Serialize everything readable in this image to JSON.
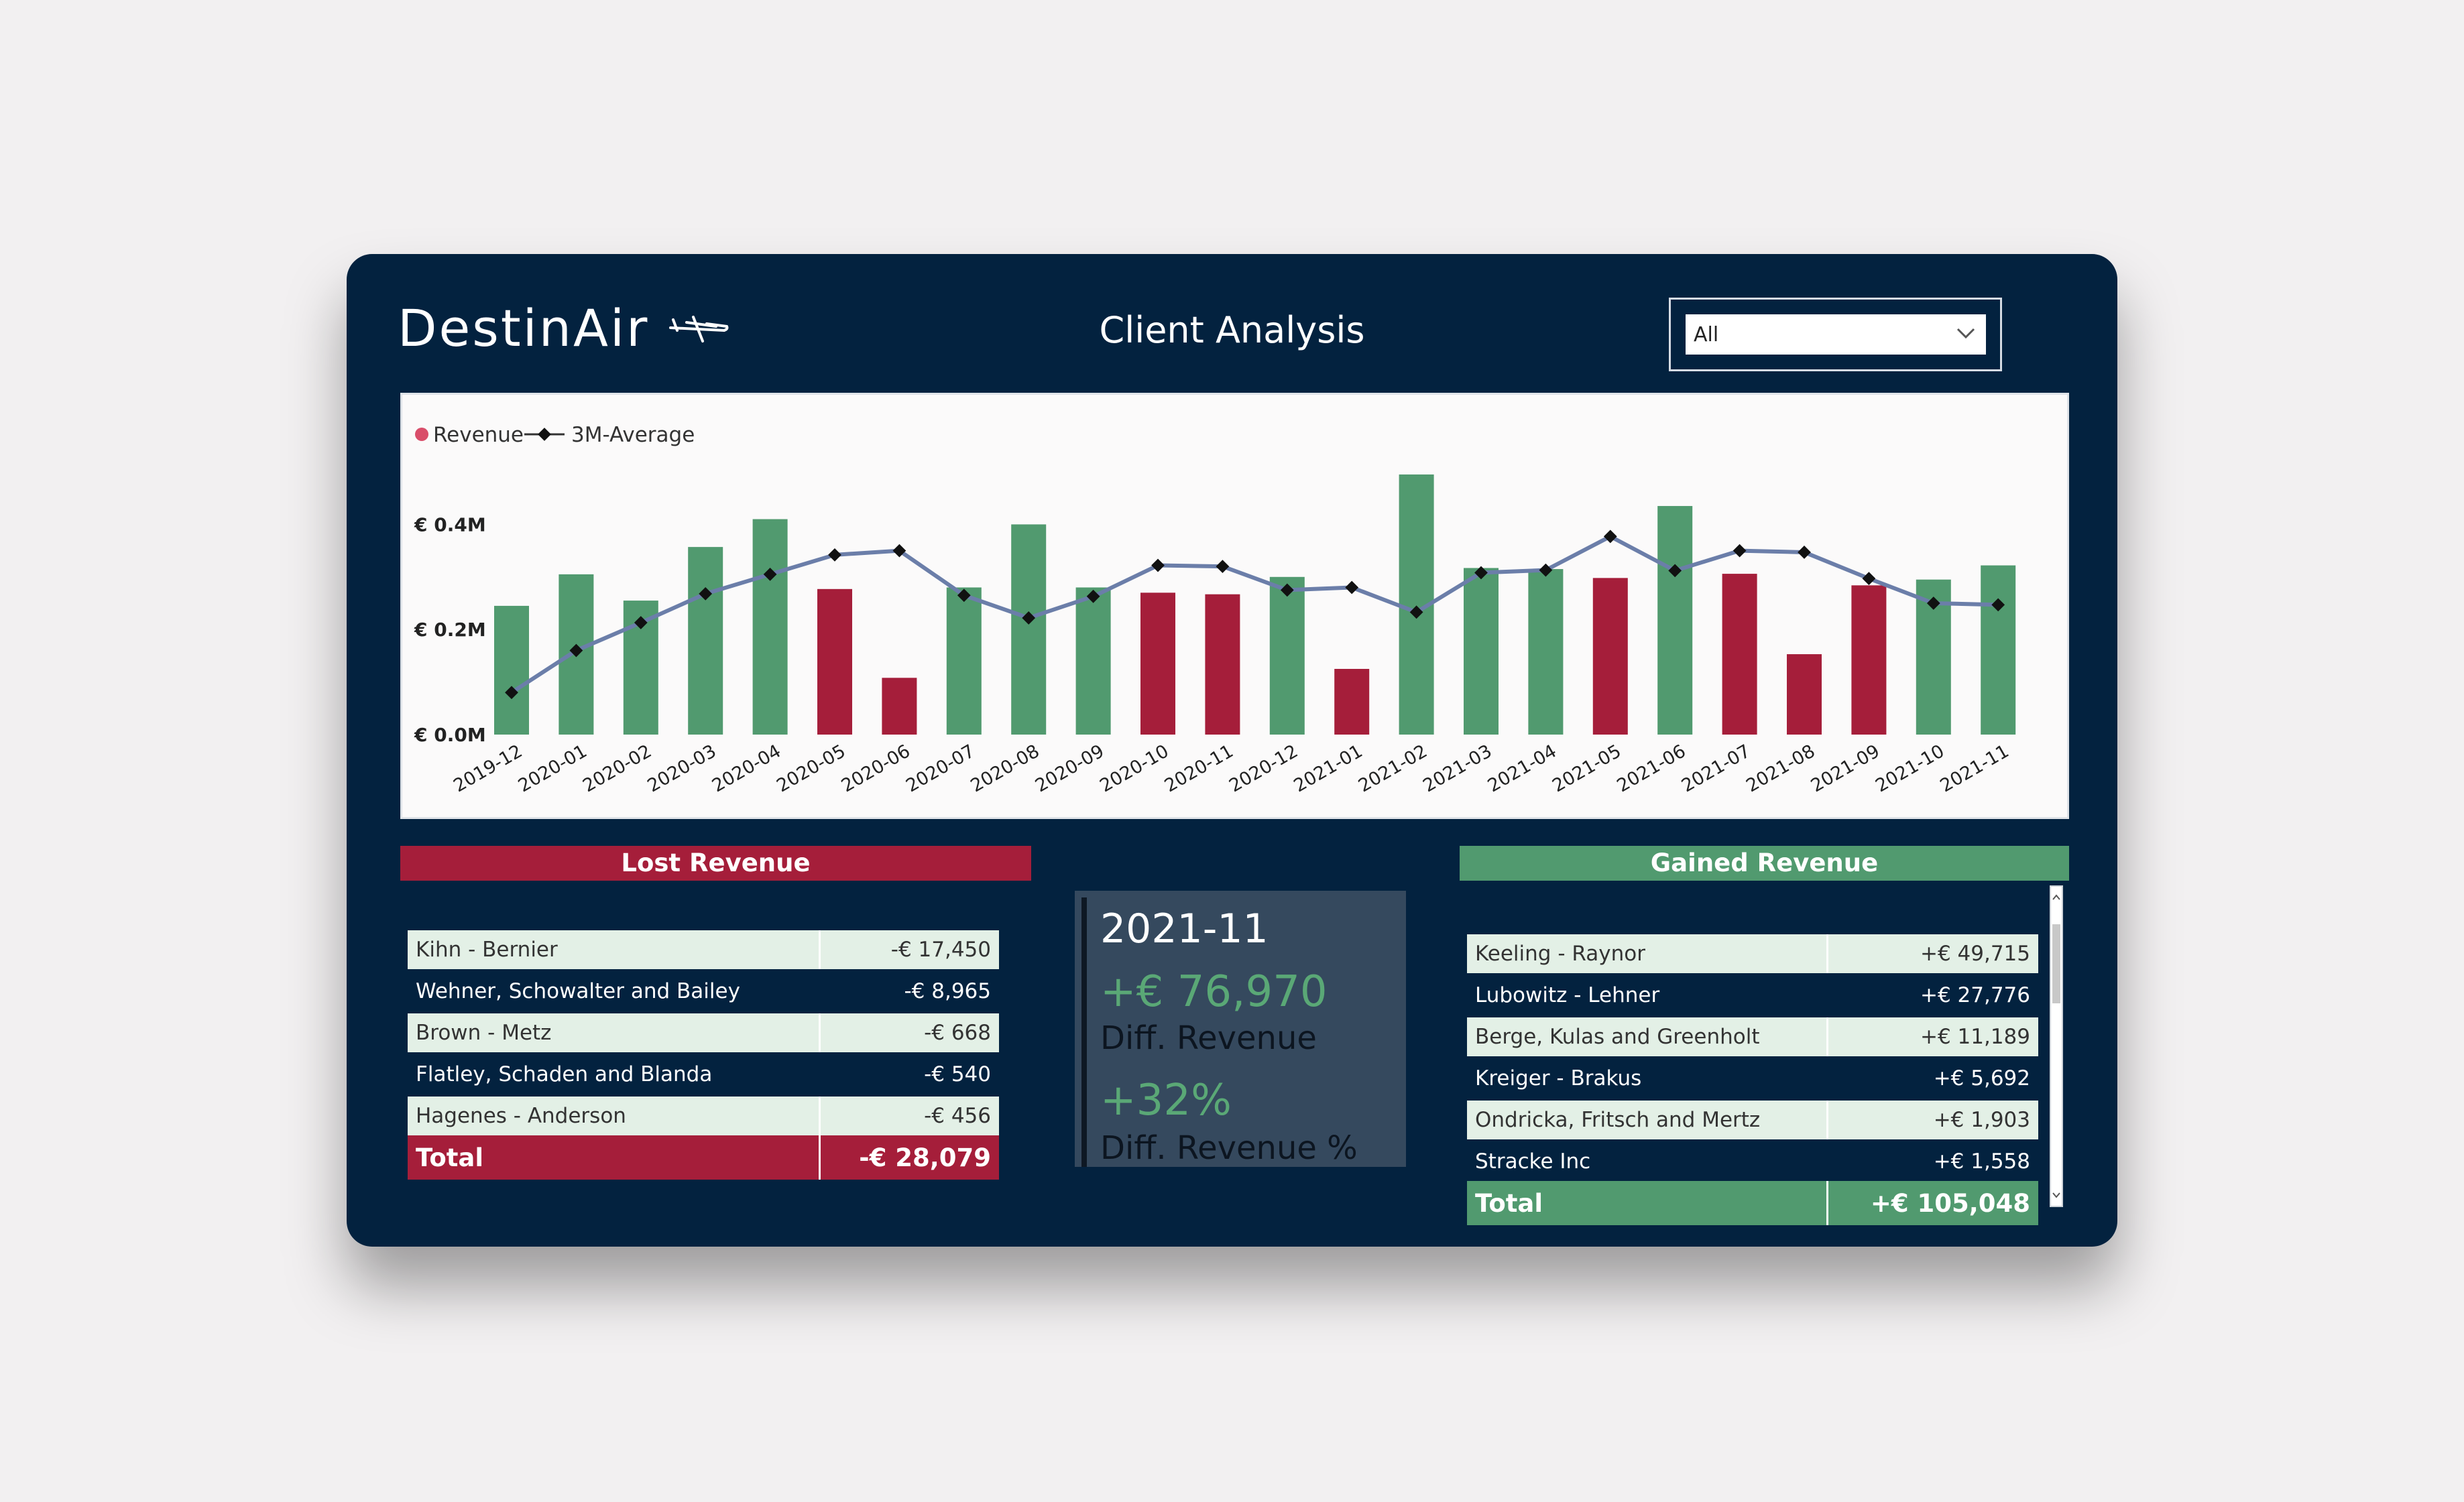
{
  "header": {
    "brand": "DestinAir",
    "title": "Client Analysis",
    "filter_value": "All"
  },
  "colors": {
    "card_bg": "#03223f",
    "positive": "#519a6f",
    "negative": "#a51e3a",
    "average_line": "#6b7ea9",
    "legend_revenue_dot": "#d94e6a"
  },
  "chart_data": {
    "type": "bar",
    "legend": [
      "Revenue",
      "3M-Average"
    ],
    "legend_placement": "top-left",
    "y_ticks": [
      "€ 0.0M",
      "€ 0.2M",
      "€ 0.4M"
    ],
    "ylim": [
      0,
      0.5
    ],
    "grid": false,
    "categories": [
      "2019-12",
      "2020-01",
      "2020-02",
      "2020-03",
      "2020-04",
      "2020-05",
      "2020-06",
      "2020-07",
      "2020-08",
      "2020-09",
      "2020-10",
      "2020-11",
      "2020-12",
      "2021-01",
      "2021-02",
      "2021-03",
      "2021-04",
      "2021-05",
      "2021-06",
      "2021-07",
      "2021-08",
      "2021-09",
      "2021-10",
      "2021-11"
    ],
    "series": [
      {
        "name": "Revenue",
        "values": [
          0.245,
          0.305,
          0.255,
          0.357,
          0.41,
          0.277,
          0.108,
          0.28,
          0.4,
          0.28,
          0.27,
          0.267,
          0.3,
          0.125,
          0.495,
          0.317,
          0.315,
          0.298,
          0.435,
          0.306,
          0.153,
          0.284,
          0.295,
          0.322
        ],
        "polarity": [
          "up",
          "up",
          "up",
          "up",
          "up",
          "down",
          "down",
          "up",
          "up",
          "up",
          "down",
          "down",
          "up",
          "down",
          "up",
          "up",
          "up",
          "down",
          "up",
          "down",
          "down",
          "down",
          "up",
          "up"
        ]
      },
      {
        "name": "3M-Average",
        "values": [
          0.08,
          0.16,
          0.213,
          0.268,
          0.305,
          0.342,
          0.35,
          0.265,
          0.222,
          0.263,
          0.322,
          0.32,
          0.275,
          0.28,
          0.233,
          0.308,
          0.313,
          0.377,
          0.312,
          0.35,
          0.347,
          0.297,
          0.25,
          0.247
        ]
      }
    ]
  },
  "lost": {
    "title": "Lost Revenue",
    "rows": [
      {
        "name": "Kihn - Bernier",
        "value": "-€ 17,450"
      },
      {
        "name": "Wehner, Schowalter and Bailey",
        "value": "-€ 8,965"
      },
      {
        "name": "Brown - Metz",
        "value": "-€ 668"
      },
      {
        "name": "Flatley, Schaden and Blanda",
        "value": "-€ 540"
      },
      {
        "name": "Hagenes - Anderson",
        "value": "-€ 456"
      }
    ],
    "total_label": "Total",
    "total_value": "-€ 28,079"
  },
  "kpi": {
    "period": "2021-11",
    "diff_revenue": "+€ 76,970",
    "diff_revenue_label": "Diff. Revenue",
    "diff_pct": "+32%",
    "diff_pct_label": "Diff. Revenue %"
  },
  "gained": {
    "title": "Gained Revenue",
    "rows": [
      {
        "name": "Keeling - Raynor",
        "value": "+€ 49,715"
      },
      {
        "name": "Lubowitz - Lehner",
        "value": "+€ 27,776"
      },
      {
        "name": "Berge, Kulas and Greenholt",
        "value": "+€ 11,189"
      },
      {
        "name": "Kreiger - Brakus",
        "value": "+€ 5,692"
      },
      {
        "name": "Ondricka, Fritsch and Mertz",
        "value": "+€ 1,903"
      },
      {
        "name": "Stracke Inc",
        "value": "+€ 1,558"
      }
    ],
    "total_label": "Total",
    "total_value": "+€ 105,048"
  }
}
